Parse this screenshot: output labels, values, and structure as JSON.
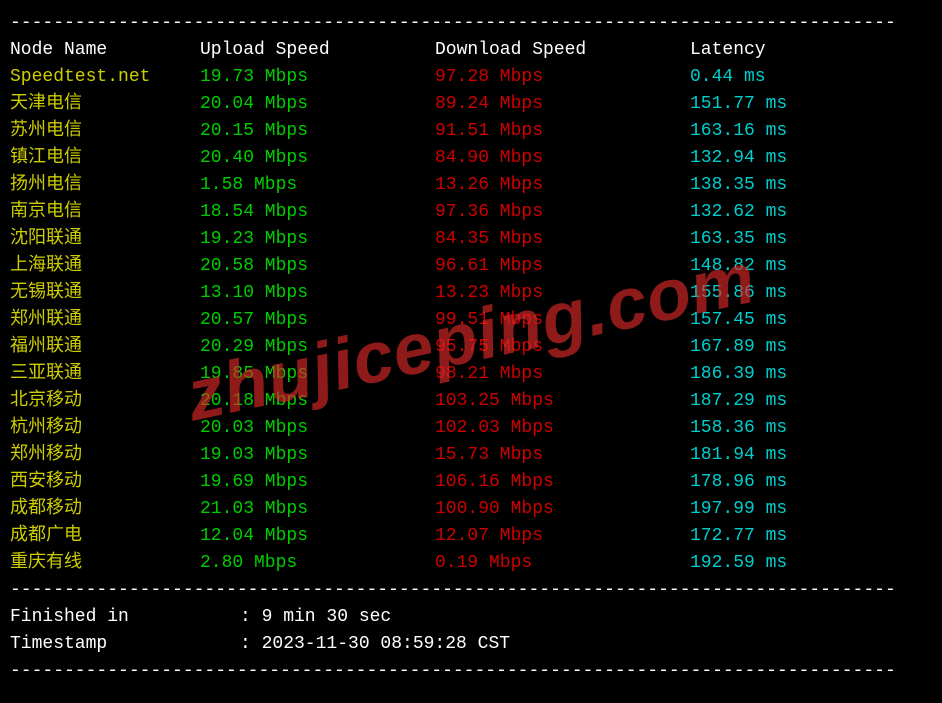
{
  "headers": {
    "node": "Node Name",
    "upload": "Upload Speed",
    "download": "Download Speed",
    "latency": "Latency"
  },
  "speedtest_row": {
    "node": "Speedtest.net",
    "upload": "19.73 Mbps",
    "download": "97.28 Mbps",
    "latency": "0.44 ms"
  },
  "rows": [
    {
      "node": "天津电信",
      "upload": "20.04 Mbps",
      "download": "89.24 Mbps",
      "latency": "151.77 ms"
    },
    {
      "node": "苏州电信",
      "upload": "20.15 Mbps",
      "download": "91.51 Mbps",
      "latency": "163.16 ms"
    },
    {
      "node": "镇江电信",
      "upload": "20.40 Mbps",
      "download": "84.90 Mbps",
      "latency": "132.94 ms"
    },
    {
      "node": "扬州电信",
      "upload": "1.58 Mbps",
      "download": "13.26 Mbps",
      "latency": "138.35 ms"
    },
    {
      "node": "南京电信",
      "upload": "18.54 Mbps",
      "download": "97.36 Mbps",
      "latency": "132.62 ms"
    },
    {
      "node": "沈阳联通",
      "upload": "19.23 Mbps",
      "download": "84.35 Mbps",
      "latency": "163.35 ms"
    },
    {
      "node": "上海联通",
      "upload": "20.58 Mbps",
      "download": "96.61 Mbps",
      "latency": "148.82 ms"
    },
    {
      "node": "无锡联通",
      "upload": "13.10 Mbps",
      "download": "13.23 Mbps",
      "latency": "155.86 ms"
    },
    {
      "node": "郑州联通",
      "upload": "20.57 Mbps",
      "download": "99.51 Mbps",
      "latency": "157.45 ms"
    },
    {
      "node": "福州联通",
      "upload": "20.29 Mbps",
      "download": "95.75 Mbps",
      "latency": "167.89 ms"
    },
    {
      "node": "三亚联通",
      "upload": "19.85 Mbps",
      "download": "98.21 Mbps",
      "latency": "186.39 ms"
    },
    {
      "node": "北京移动",
      "upload": "20.18 Mbps",
      "download": "103.25 Mbps",
      "latency": "187.29 ms"
    },
    {
      "node": "杭州移动",
      "upload": "20.03 Mbps",
      "download": "102.03 Mbps",
      "latency": "158.36 ms"
    },
    {
      "node": "郑州移动",
      "upload": "19.03 Mbps",
      "download": "15.73 Mbps",
      "latency": "181.94 ms"
    },
    {
      "node": "西安移动",
      "upload": "19.69 Mbps",
      "download": "106.16 Mbps",
      "latency": "178.96 ms"
    },
    {
      "node": "成都移动",
      "upload": "21.03 Mbps",
      "download": "100.90 Mbps",
      "latency": "197.99 ms"
    },
    {
      "node": "成都广电",
      "upload": "12.04 Mbps",
      "download": "12.07 Mbps",
      "latency": "172.77 ms"
    },
    {
      "node": "重庆有线",
      "upload": "2.80 Mbps",
      "download": "0.19 Mbps",
      "latency": "192.59 ms"
    }
  ],
  "footer": {
    "finished_label": "Finished in",
    "finished_value": ": 9 min 30 sec",
    "timestamp_label": "Timestamp",
    "timestamp_value": ": 2023-11-30 08:59:28 CST"
  },
  "dashes": "----------------------------------------------------------------------------------",
  "watermark": "zhujiceping.com"
}
